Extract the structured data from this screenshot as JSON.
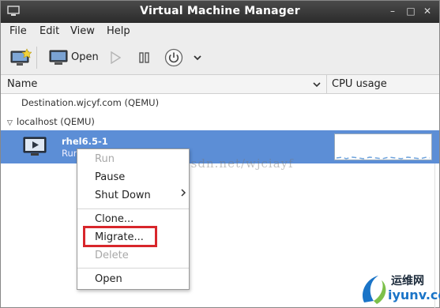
{
  "window": {
    "title": "Virtual Machine Manager"
  },
  "titlebar_buttons": {
    "minimize": "–",
    "maximize": "□",
    "close": "✕"
  },
  "menubar": [
    "File",
    "Edit",
    "View",
    "Help"
  ],
  "toolbar": {
    "open_label": "Open"
  },
  "columns": {
    "name": "Name",
    "cpu": "CPU usage"
  },
  "connections": [
    {
      "label": "Destination.wjcyf.com (QEMU)",
      "expanded": false
    },
    {
      "label": "localhost (QEMU)",
      "expanded": true
    }
  ],
  "vm": {
    "name": "rhel6.5-1",
    "status": "Running"
  },
  "context_menu": {
    "run": "Run",
    "pause": "Pause",
    "shutdown": "Shut Down",
    "clone": "Clone...",
    "migrate": "Migrate...",
    "delete": "Delete",
    "open": "Open"
  },
  "watermark": "http://blog.csdn.net/wjciayf",
  "logo": {
    "line1": "运维网",
    "line2": "iyunv.com"
  },
  "colors": {
    "selection": "#5c8ed6",
    "highlight_box": "#d8262b",
    "titlebar": "#2b2b2b"
  }
}
